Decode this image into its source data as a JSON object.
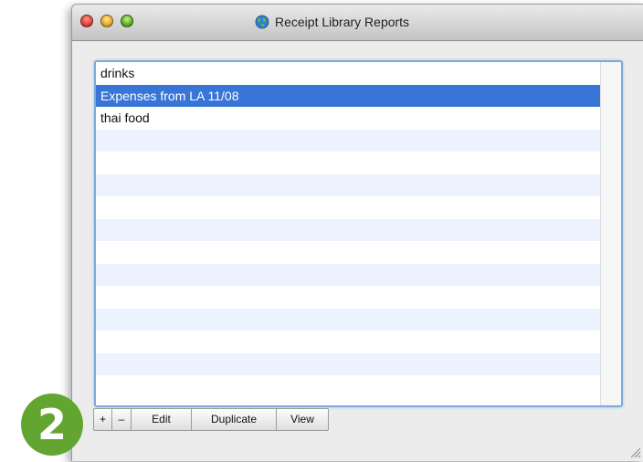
{
  "window": {
    "title": "Receipt Library Reports"
  },
  "reports": [
    {
      "label": "drinks",
      "selected": false
    },
    {
      "label": "Expenses from LA 11/08",
      "selected": true
    },
    {
      "label": "thai food",
      "selected": false
    },
    {
      "label": "",
      "selected": false
    },
    {
      "label": "",
      "selected": false
    },
    {
      "label": "",
      "selected": false
    },
    {
      "label": "",
      "selected": false
    },
    {
      "label": "",
      "selected": false
    },
    {
      "label": "",
      "selected": false
    },
    {
      "label": "",
      "selected": false
    },
    {
      "label": "",
      "selected": false
    },
    {
      "label": "",
      "selected": false
    },
    {
      "label": "",
      "selected": false
    },
    {
      "label": "",
      "selected": false
    },
    {
      "label": "",
      "selected": false
    }
  ],
  "toolbar": {
    "add_label": "+",
    "remove_label": "–",
    "edit_label": "Edit",
    "duplicate_label": "Duplicate",
    "view_label": "View"
  },
  "annotation": {
    "step_number": "2"
  },
  "icons": {
    "title_icon": "globe-icon",
    "close": "close-button",
    "minimize": "minimize-button",
    "zoom": "zoom-button",
    "resize": "resize-grip-icon"
  },
  "colors": {
    "selection": "#3875d7",
    "focus_ring": "#7fa8dc",
    "stripe": "#edf3fe",
    "badge": "#63a531"
  }
}
